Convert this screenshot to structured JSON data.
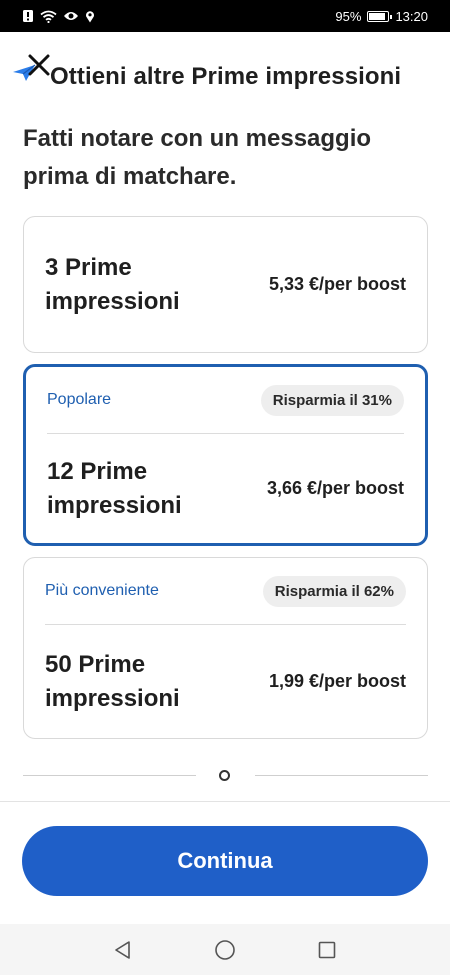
{
  "status_bar": {
    "battery": "95%",
    "time": "13:20"
  },
  "header": {
    "title": "Ottieni altre Prime impressioni"
  },
  "subtitle": "Fatti notare con un messaggio prima di matchare.",
  "plans": [
    {
      "name": "3 Prime impressioni",
      "price": "5,33 €/per boost"
    },
    {
      "tag": "Popolare",
      "badge": "Risparmia il 31%",
      "name": "12 Prime impressioni",
      "price": "3,66 €/per boost",
      "selected": true
    },
    {
      "tag": "Più conveniente",
      "badge": "Risparmia il 62%",
      "name": "50 Prime impressioni",
      "price": "1,99 €/per boost"
    }
  ],
  "cta": {
    "label": "Continua"
  },
  "colors": {
    "accent": "#1f5fb0",
    "button": "#1f5fc8"
  }
}
